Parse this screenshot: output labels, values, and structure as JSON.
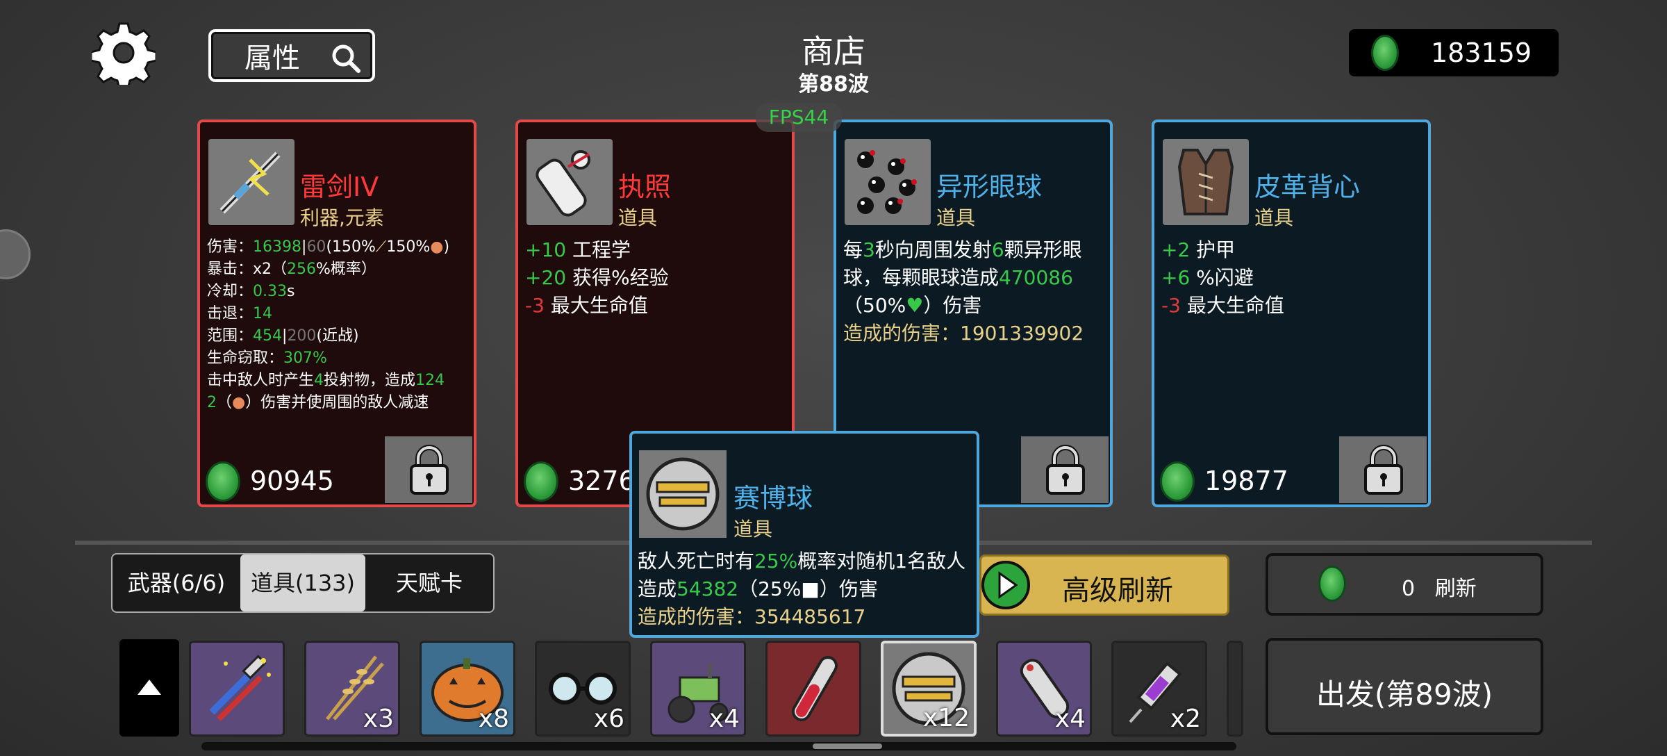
{
  "header": {
    "search_label": "属性",
    "title": "商店",
    "wave": "第88波",
    "money": "183159",
    "fps": "FPS44"
  },
  "cards": [
    {
      "name": "雷剑IV",
      "category": "利器,元素",
      "price": "90945",
      "rarity_color": "#e24a4a",
      "icon": "lightning-sword-icon"
    },
    {
      "name": "执照",
      "category": "道具",
      "price": "3276",
      "stats": [
        {
          "value": "+10",
          "text": " 工程学"
        },
        {
          "value": "+20",
          "text": " 获得%经验"
        },
        {
          "value": "-3",
          "text": " 最大生命值"
        }
      ],
      "rarity_color": "#e24a4a",
      "icon": "scroll-icon"
    },
    {
      "name": "异形眼球",
      "category": "道具",
      "damage_label": "造成的伤害：1901339902",
      "rarity_color": "#4fa7dc",
      "icon": "alien-eyes-icon"
    },
    {
      "name": "皮革背心",
      "category": "道具",
      "price": "19877",
      "stats": [
        {
          "value": "+2",
          "text": " 护甲"
        },
        {
          "value": "+6",
          "text": " %闪避"
        },
        {
          "value": "-3",
          "text": " 最大生命值"
        }
      ],
      "rarity_color": "#4fa7dc",
      "icon": "leather-vest-icon"
    }
  ],
  "weapon_stats": {
    "damage_label": "伤害：",
    "damage": "16398",
    "damage_base": "60",
    "damage_scale": "(150%",
    "damage_scale2": "150%",
    "crit_label": "暴击：x2（",
    "crit_chance": "256",
    "crit_suffix": "%概率）",
    "cooldown_label": "冷却：",
    "cooldown": "0.33",
    "cooldown_unit": "s",
    "knockback_label": "击退：",
    "knockback": "14",
    "range_label": "范围：",
    "range": "454",
    "range_base": "200",
    "range_type": "(近战)",
    "lifesteal_label": "生命窃取：",
    "lifesteal": "307%",
    "effect_a": "击中敌人时产生",
    "effect_count": "4",
    "effect_b": "投射物，造成",
    "effect_dmg1": "124",
    "effect_dmg2": "2",
    "effect_c": "（",
    "effect_d": "）伤害并使周围的敌人减速"
  },
  "alien_eyes": {
    "a": "每",
    "secs": "3",
    "b": "秒向周围发射",
    "count": "6",
    "c": "颗异形眼球，每颗眼球造成",
    "dmg": "470086",
    "d": "（50%",
    "e": "）伤害"
  },
  "tooltip": {
    "name": "赛博球",
    "category": "道具",
    "a": "敌人死亡时有",
    "chance": "25%",
    "b": "概率对随机1名敌人造成",
    "dmg": "54382",
    "c": "（25%",
    "d": "）伤害",
    "damage_label": "造成的伤害：354485617",
    "icon": "cyber-ball-icon"
  },
  "tabs": [
    {
      "label": "武器(6/6)",
      "active": false
    },
    {
      "label": "道具(133)",
      "active": true
    },
    {
      "label": "天赋卡",
      "active": false
    }
  ],
  "buttons": {
    "advanced_refresh": "高级刷新",
    "refresh_cost": "0",
    "refresh": "刷新",
    "depart": "出发(第89波)"
  },
  "inventory": [
    {
      "icon": "tools-icon",
      "count": ""
    },
    {
      "icon": "wheat-icon",
      "count": "x3"
    },
    {
      "icon": "pumpkin-icon",
      "count": "x8"
    },
    {
      "icon": "glasses-icon",
      "count": "x6"
    },
    {
      "icon": "tractor-icon",
      "count": "x4"
    },
    {
      "icon": "test-tube-icon",
      "count": ""
    },
    {
      "icon": "cyber-ball-icon",
      "count": "x12"
    },
    {
      "icon": "missile-icon",
      "count": "x4"
    },
    {
      "icon": "syringe-icon",
      "count": "x2"
    }
  ]
}
